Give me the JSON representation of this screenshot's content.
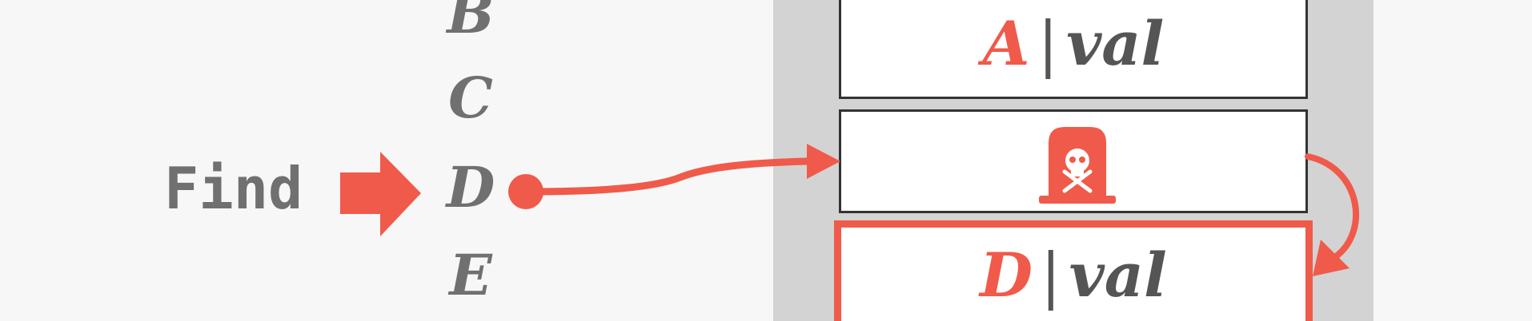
{
  "find": {
    "label": "Find"
  },
  "keys": [
    "B",
    "C",
    "D",
    "E"
  ],
  "pointer_key": "D",
  "entries": [
    {
      "key": "A",
      "separator": "|",
      "value": "val"
    },
    {
      "key": "",
      "tombstone": true,
      "icon": "tombstone-skull-icon"
    },
    {
      "key": "D",
      "separator": "|",
      "value": "val",
      "highlighted": true
    }
  ],
  "colors": {
    "accent": "#f05a4a",
    "key_text": "#707070",
    "page_background": "#d3d3d3",
    "canvas_background": "#f7f7f7"
  }
}
